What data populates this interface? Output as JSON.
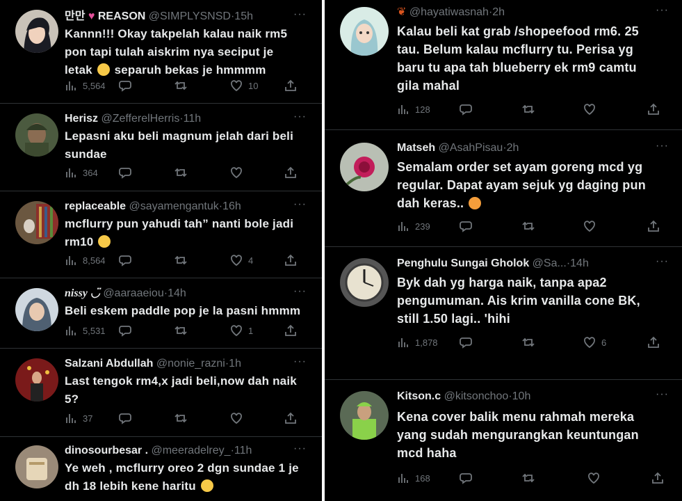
{
  "left_tweets": [
    {
      "name": "만만",
      "name_suffix": "REASON",
      "handle": "@SIMPLYSNSD",
      "time": "15h",
      "text": "Kannn!!! Okay takpelah kalau naik rm5 pon tapi tulah aiskrim nya seciput je letak 😢 separuh bekas je hmmmm",
      "lines": [
        "Kannn!!! Okay takpelah kalau naik rm5",
        "pon tapi tulah aiskrim nya seciput je",
        "letak",
        "separuh bekas je hmmmm"
      ],
      "views": "5,564",
      "likes": "10"
    },
    {
      "name": "Herisz",
      "handle": "@ZefferelHerris",
      "time": "11h",
      "lines": [
        "Lepasni aku beli magnum jelah dari beli",
        "sundae"
      ],
      "views": "364",
      "likes": ""
    },
    {
      "name": "replaceable",
      "handle": "@sayamengantuk",
      "time": "16h",
      "lines": [
        "mcflurry pun yahudi tah” nanti bole jadi",
        "rm10"
      ],
      "views": "8,564",
      "likes": "4"
    },
    {
      "name": "nissy ◡̈",
      "handle": "@aaraaeiou",
      "time": "14h",
      "lines": [
        "Beli eskem paddle pop je la pasni hmmm"
      ],
      "views": "5,531",
      "likes": "1"
    },
    {
      "name": "Salzani Abdullah",
      "handle": "@nonie_razni",
      "time": "1h",
      "lines": [
        "Last tengok rm4,x jadi beli,now dah naik",
        "5?"
      ],
      "views": "37",
      "likes": ""
    },
    {
      "name": "dinosourbesar .",
      "handle": "@meeradelrey_",
      "time": "11h",
      "lines": [
        "Ye weh , mcflurry oreo 2 dgn sundae 1 je",
        "dh 18 lebih kene haritu"
      ],
      "views": "",
      "likes": ""
    }
  ],
  "right_tweets": [
    {
      "name": "",
      "handle": "@hayatiwasnah",
      "time": "2h",
      "lines": [
        "Kalau beli kat grab /shopeefood rm6. 25",
        "tau. Belum kalau mcflurry tu. Perisa yg",
        "baru tu apa tah blueberry ek rm9 camtu",
        "gila mahal"
      ],
      "views": "128",
      "likes": ""
    },
    {
      "name": "Matseh",
      "handle": "@AsahPisau",
      "time": "2h",
      "lines": [
        "Semalam order set ayam goreng mcd yg",
        "regular. Dapat ayam sejuk yg daging pun",
        "dah keras.."
      ],
      "views": "239",
      "likes": ""
    },
    {
      "name": "Penghulu Sungai Gholok",
      "handle": "@Sa...",
      "time": "14h",
      "lines": [
        "Byk dah yg harga naik, tanpa apa2",
        "pengumuman. Ais krim vanilla cone BK,",
        "still 1.50 lagi.. 'hihi"
      ],
      "views": "1,878",
      "likes": "6"
    },
    {
      "name": "Kitson.c",
      "handle": "@kitsonchoo",
      "time": "10h",
      "lines": [
        "Kena cover balik menu rahmah mereka",
        "yang sudah mengurangkan keuntungan",
        "mcd haha"
      ],
      "views": "168",
      "likes": ""
    }
  ],
  "icons": {
    "more": "more-icon",
    "views": "views-icon",
    "reply": "reply-icon",
    "retweet": "retweet-icon",
    "like": "like-icon",
    "share": "share-icon"
  },
  "separator": "·",
  "more_glyph": "···"
}
